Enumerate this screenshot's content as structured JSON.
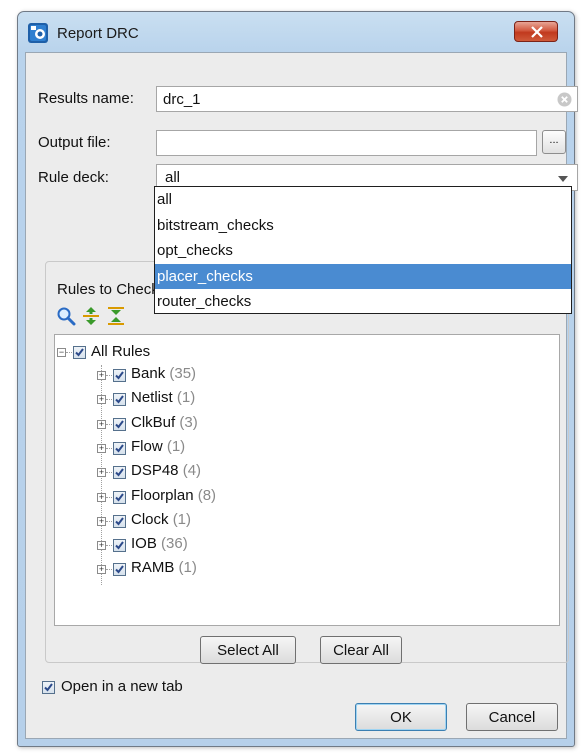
{
  "window": {
    "title": "Report DRC"
  },
  "form": {
    "results_name_label": "Results name:",
    "results_name_value": "drc_1",
    "output_file_label": "Output file:",
    "output_file_value": "",
    "browse_label": "...",
    "rule_deck_label": "Rule deck:",
    "rule_deck_value": "all"
  },
  "dropdown": {
    "options": [
      "all",
      "bitstream_checks",
      "opt_checks",
      "placer_checks",
      "router_checks"
    ],
    "highlighted": "placer_checks"
  },
  "rules": {
    "group_title": "Rules to Check",
    "root_label": "All Rules",
    "items": [
      {
        "label": "Bank",
        "count": "(35)"
      },
      {
        "label": "Netlist",
        "count": "(1)"
      },
      {
        "label": "ClkBuf",
        "count": "(3)"
      },
      {
        "label": "Flow",
        "count": "(1)"
      },
      {
        "label": "DSP48",
        "count": "(4)"
      },
      {
        "label": "Floorplan",
        "count": "(8)"
      },
      {
        "label": "Clock",
        "count": "(1)"
      },
      {
        "label": "IOB",
        "count": "(36)"
      },
      {
        "label": "RAMB",
        "count": "(1)"
      }
    ],
    "select_all_label": "Select All",
    "clear_all_label": "Clear All"
  },
  "footer": {
    "open_new_tab_label": "Open in a new tab",
    "open_new_tab_checked": true,
    "ok_label": "OK",
    "cancel_label": "Cancel"
  },
  "colors": {
    "selection": "#4a8bd1",
    "close_button": "#c1391e",
    "title_bar": "#b9d3ec"
  },
  "icons": [
    "app-icon",
    "close-icon",
    "clear-field-icon",
    "search-icon",
    "expand-all-icon",
    "collapse-all-icon"
  ]
}
